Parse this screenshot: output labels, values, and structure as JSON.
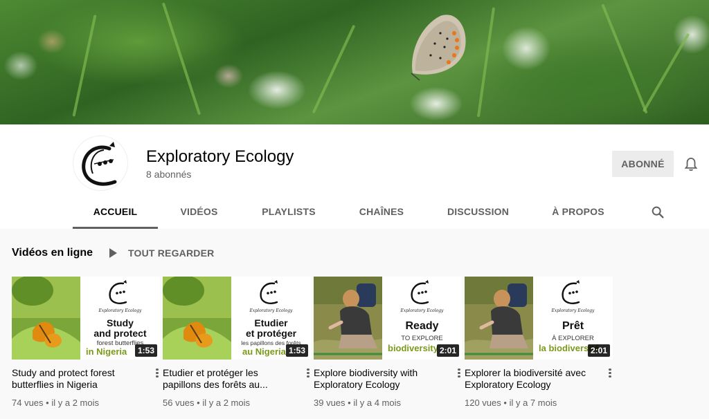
{
  "channel": {
    "name": "Exploratory Ecology",
    "subscribers": "8 abonnés",
    "subscribe_label": "ABONNÉ"
  },
  "tabs": [
    {
      "label": "ACCUEIL",
      "active": true
    },
    {
      "label": "VIDÉOS",
      "active": false
    },
    {
      "label": "PLAYLISTS",
      "active": false
    },
    {
      "label": "CHAÎNES",
      "active": false
    },
    {
      "label": "DISCUSSION",
      "active": false
    },
    {
      "label": "À PROPOS",
      "active": false
    }
  ],
  "section": {
    "title": "Vidéos en ligne",
    "play_all": "TOUT REGARDER"
  },
  "videos": [
    {
      "title": "Study and protect forest butterflies in Nigeria",
      "views": "74 vues",
      "age": "il y a 2 mois",
      "duration": "1:53",
      "thumb_brand": "Exploratory Ecology",
      "thumb_line1": "Study",
      "thumb_line2": "and protect",
      "thumb_small": "forest butterflies",
      "thumb_green": "in Nigeria"
    },
    {
      "title": "Etudier et protéger les papillons des forêts au...",
      "views": "56 vues",
      "age": "il y a 2 mois",
      "duration": "1:53",
      "thumb_brand": "Exploratory Ecology",
      "thumb_line1": "Etudier",
      "thumb_line2": "et protéger",
      "thumb_small": "les papillons des forêts",
      "thumb_green": "au Nigeria"
    },
    {
      "title": "Explore biodiversity with Exploratory Ecology",
      "views": "39 vues",
      "age": "il y a 4 mois",
      "duration": "2:01",
      "thumb_brand": "Exploratory Ecology",
      "thumb_line1": "Ready",
      "thumb_small": "TO EXPLORE",
      "thumb_green": "biodiversity"
    },
    {
      "title": "Explorer la biodiversité avec Exploratory Ecology",
      "views": "120 vues",
      "age": "il y a 7 mois",
      "duration": "2:01",
      "thumb_brand": "Exploratory Ecology",
      "thumb_line1": "Prêt",
      "thumb_small": "À EXPLORER",
      "thumb_green": "la biodiversité"
    }
  ],
  "separator": "•",
  "icons": {
    "bell": "bell-icon",
    "search": "search-icon",
    "play": "play-icon",
    "more": "more-vert-icon"
  },
  "colors": {
    "text_primary": "#030303",
    "text_secondary": "#606060",
    "subscribe_bg": "#ececec",
    "thumb_green": "#7a9a1a"
  }
}
